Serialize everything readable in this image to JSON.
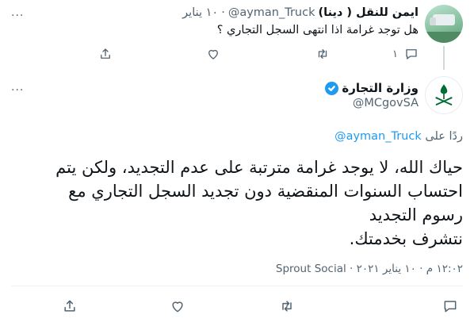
{
  "parent_tweet": {
    "author_name": "ايمن للنقل ( دينا)",
    "author_handle": "@ayman_Truck",
    "separator": "·",
    "date": "١٠ يناير",
    "text": "هل توجد غرامة اذا انتهى السجل التجاري ؟",
    "more_label": "...",
    "reply_count": "١",
    "actions": {
      "reply": "reply-icon",
      "retweet": "retweet-icon",
      "like": "heart-icon",
      "share": "share-icon"
    }
  },
  "main_tweet": {
    "author_name": "وزارة التجارة",
    "author_handle": "@MCgovSA",
    "verified": true,
    "more_label": "...",
    "reply_to_prefix": "ردًا على",
    "reply_to_handle": "@ayman_Truck",
    "body_lines": [
      "حياك الله، لا يوجد غرامة مترتبة على عدم التجديد، ولكن يتم",
      "احتساب السنوات المنقضية دون تجديد السجل التجاري مع",
      "رسوم التجديد",
      "نتشرف بخدمتك."
    ],
    "time": "١٢:٠٢ م",
    "date": "١٠ يناير ٢٠٢١",
    "separator": "·",
    "source": "Sprout Social"
  },
  "colors": {
    "text": "#0f1419",
    "muted": "#536471",
    "link": "#1d9bf0",
    "verified": "#1d9bf0",
    "brand_green": "#006c35"
  }
}
